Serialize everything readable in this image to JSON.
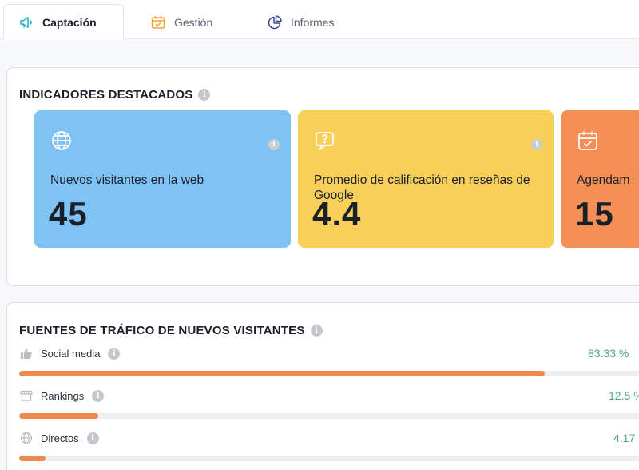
{
  "tabs": [
    {
      "label": "Captación",
      "icon": "megaphone-icon",
      "active": true
    },
    {
      "label": "Gestión",
      "icon": "calendar-icon",
      "active": false
    },
    {
      "label": "Informes",
      "icon": "pie-chart-icon",
      "active": false
    }
  ],
  "highlights": {
    "title": "INDICADORES DESTACADOS",
    "cards": [
      {
        "label": "Nuevos visitantes en la web",
        "value": "45",
        "icon": "globe-icon",
        "color": "#7ec3f3"
      },
      {
        "label": "Promedio de calificación en reseñas de Google",
        "value": "4.4",
        "icon": "question-bubble-icon",
        "color": "#f8cf59"
      },
      {
        "label": "Agendam",
        "value": "15",
        "icon": "calendar-check-icon",
        "color": "#f58f55"
      }
    ]
  },
  "traffic": {
    "title": "FUENTES DE TRÁFICO DE NUEVOS VISITANTES",
    "rows": [
      {
        "label": "Social media",
        "percent_text": "83.33 %",
        "fraction": 0.8333,
        "icon": "thumbs-up-icon"
      },
      {
        "label": "Rankings",
        "percent_text": "12.5 %",
        "fraction": 0.125,
        "icon": "storefront-icon"
      },
      {
        "label": "Directos",
        "percent_text": "4.17",
        "fraction": 0.0417,
        "icon": "globe-icon"
      }
    ]
  },
  "colors": {
    "accent_orange": "#f0884f",
    "percent_green": "#4fa877",
    "tab_icon_teal": "#28b1c4",
    "tab_icon_orange": "#f0a531",
    "tab_icon_navy": "#3a4a8a"
  }
}
